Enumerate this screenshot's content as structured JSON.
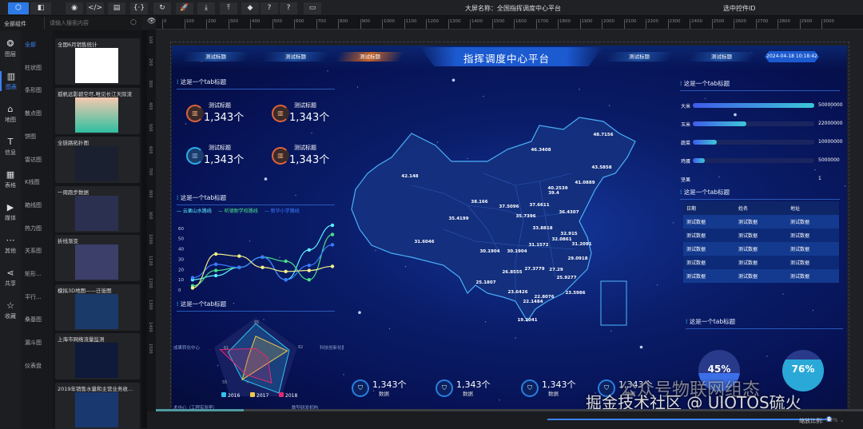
{
  "toolbar": {
    "buttons": [
      "cube-icon",
      "panel-icon",
      "eye-icon",
      "code-icon",
      "save-icon",
      "braces-icon",
      "refresh-icon",
      "rocket-icon",
      "download-icon",
      "upload-icon",
      "package-icon",
      "help-icon",
      "help-circle-icon",
      "keyboard-icon"
    ],
    "screen_name_label": "大屏名称：",
    "screen_name": "全国指挥调度中心平台",
    "selected_id_label": "选中控件ID"
  },
  "left_panel": {
    "tab": "全部组件",
    "search_placeholder": "请输入搜索内容",
    "icon_nav": [
      {
        "label": "图层",
        "icon": "layers"
      },
      {
        "label": "图表",
        "icon": "bar-chart"
      },
      {
        "label": "地图",
        "icon": "map"
      },
      {
        "label": "信息",
        "icon": "text"
      },
      {
        "label": "表格",
        "icon": "table"
      },
      {
        "label": "媒体",
        "icon": "media"
      },
      {
        "label": "其他",
        "icon": "more"
      },
      {
        "label": "共享",
        "icon": "share"
      },
      {
        "label": "收藏",
        "icon": "star"
      }
    ],
    "categories": [
      "全部",
      "柱状图",
      "条形图",
      "散点图",
      "饼图",
      "雷达图",
      "K线图",
      "箱线图",
      "热力图",
      "关系图",
      "矩形...",
      "平行...",
      "桑基图",
      "漏斗图",
      "仪表盘"
    ],
    "thumbnails": [
      "全国6月销售统计",
      "孤帆远影碧空尽,唯见长江天际流",
      "全链路拓扑图",
      "一周跑步数据",
      "折线渐变",
      "模拟3D地图——迁徙图",
      "上海市网络流量监测",
      "2019年销售水量和主营业务收..."
    ]
  },
  "ruler": {
    "h": [
      "0",
      "100",
      "200",
      "300",
      "400",
      "500",
      "600",
      "700",
      "800",
      "900",
      "1000",
      "1100",
      "1200",
      "1300",
      "1400",
      "1500",
      "1600",
      "1700",
      "1800",
      "1900",
      "2000",
      "2100",
      "2200",
      "2300",
      "2400",
      "2500",
      "2600",
      "2700",
      "2800",
      "2900",
      "3000"
    ],
    "v": [
      "100",
      "200",
      "300",
      "400",
      "500",
      "600",
      "700",
      "800",
      "900",
      "1000",
      "1100",
      "1200",
      "1300",
      "1400",
      "1500"
    ]
  },
  "dashboard": {
    "title": "指挥调度中心平台",
    "header_tabs_left": [
      "测试标题",
      "测试标题",
      "测试标题"
    ],
    "header_tabs_right": [
      "测试标题",
      "测试标题"
    ],
    "datetime": "2024-04-18 10:18:42",
    "section_title": "这是一个tab标题",
    "stats": [
      {
        "label": "测试标题",
        "value": "1,343个"
      },
      {
        "label": "测试标题",
        "value": "1,343个"
      },
      {
        "label": "测试标题",
        "value": "1,343个"
      },
      {
        "label": "测试标题",
        "value": "1,343个"
      }
    ],
    "bottom_stats": [
      {
        "value": "1,343个",
        "label": "数据"
      },
      {
        "value": "1,343个",
        "label": "数据"
      },
      {
        "value": "1,343个",
        "label": "数据"
      },
      {
        "value": "1,343个",
        "label": "数据"
      }
    ],
    "bars": [
      {
        "name": "大米",
        "value": "50000000",
        "pct": 100
      },
      {
        "name": "玉米",
        "value": "22000000",
        "pct": 44
      },
      {
        "name": "蔬菜",
        "value": "10000000",
        "pct": 20
      },
      {
        "name": "鸡蛋",
        "value": "5000000",
        "pct": 10
      },
      {
        "name": "坚果",
        "value": "1",
        "pct": 0
      }
    ],
    "table": {
      "headers": [
        "日期",
        "姓名",
        "地址"
      ],
      "rows": [
        [
          "测试数据",
          "测试数据",
          "测试数据"
        ],
        [
          "测试数据",
          "测试数据",
          "测试数据"
        ],
        [
          "测试数据",
          "测试数据",
          "测试数据"
        ],
        [
          "测试数据",
          "测试数据",
          "测试数据"
        ],
        [
          "测试数据",
          "测试数据",
          "测试数据"
        ]
      ]
    },
    "gauges": [
      {
        "value": "45%",
        "pct": 45,
        "color": "#3b6fe8"
      },
      {
        "value": "76%",
        "pct": 76,
        "color": "#2aa8d8"
      }
    ],
    "map_labels": [
      "42.148",
      "46.3408",
      "48.7156",
      "43.5858",
      "41.0889",
      "40.2539",
      "39.4",
      "38.166",
      "37.5096",
      "37.6611",
      "36.4307",
      "35.7396",
      "35.4199",
      "33.8818",
      "32.915",
      "32.0861",
      "31.6046",
      "31.1572",
      "31.2091",
      "30.1904",
      "30.1904",
      "29.0918",
      "26.8555",
      "27.3779",
      "27.29",
      "25.9277",
      "25.1807",
      "23.6426",
      "22.8076",
      "23.5986",
      "22.1484",
      "19.2041"
    ]
  },
  "chart_data": [
    {
      "type": "line",
      "title": "",
      "legend": [
        "云栗山水路线",
        "听德耐学校路线",
        "新华小学路线"
      ],
      "yticks": [
        "0",
        "10",
        "20",
        "30",
        "40",
        "50",
        "60"
      ],
      "ylim": [
        0,
        70
      ],
      "series": [
        {
          "name": "云栗山水路线",
          "color": "#5ef0ff",
          "values": [
            10,
            14,
            22,
            32,
            10,
            39,
            63
          ]
        },
        {
          "name": "听德耐学校路线",
          "color": "#4be08a",
          "values": [
            4,
            19,
            22,
            32,
            28,
            10,
            54
          ]
        },
        {
          "name": "新华小学路线",
          "color": "#3a7cff",
          "values": [
            12,
            25,
            22,
            32,
            10,
            24,
            44
          ]
        },
        {
          "name": "",
          "color": "#f4f08a",
          "values": [
            2,
            35,
            33,
            22,
            18,
            19,
            23
          ]
        }
      ]
    },
    {
      "type": "radar",
      "indicators": [
        "",
        "科技创新化器",
        "数型研发机构",
        "术中心（工程实验室）",
        "成果转化中心"
      ],
      "max": 100,
      "tick_labels": [
        "85",
        "82",
        "55",
        "61"
      ],
      "legend": [
        "2016",
        "2017",
        "2018"
      ],
      "series": [
        {
          "name": "2016",
          "color": "#2ec4f0",
          "values": [
            90,
            85,
            95,
            55,
            70
          ]
        },
        {
          "name": "2017",
          "color": "#f0c84a",
          "values": [
            60,
            80,
            20,
            55,
            20
          ]
        },
        {
          "name": "2018",
          "color": "#e02a70",
          "values": [
            30,
            30,
            65,
            40,
            90
          ]
        }
      ]
    }
  ],
  "bottom": {
    "zoom_label": "缩放比例:",
    "zoom_value": "79%",
    "zoom_pct": 79
  },
  "watermark": [
    "公众号物联网组态",
    "掘金技术社区 @ UIOTOS硫火"
  ]
}
